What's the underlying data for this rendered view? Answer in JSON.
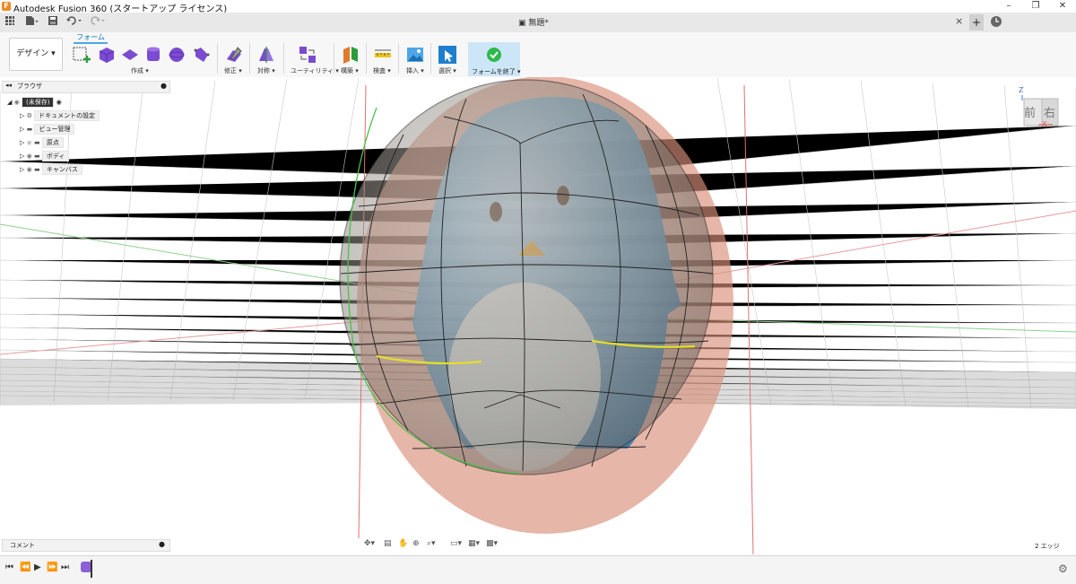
{
  "app": {
    "title": "Autodesk Fusion 360 (スタートアップ ライセンス)",
    "logo": "F",
    "window_buttons": [
      "–",
      "❐",
      "✕"
    ]
  },
  "qat": {
    "apps_icon": "apps-grid-icon",
    "file_icon": "file-icon",
    "save_icon": "save-icon",
    "undo_icon": "undo-icon",
    "redo_icon": "redo-icon",
    "document_title": "無題*",
    "close_tab": "×",
    "new_tab": "+"
  },
  "toolbar": {
    "workspace": "デザイン ▾",
    "active_tab": "フォーム",
    "groups": [
      {
        "label": "作成 ▾"
      },
      {
        "label": "修正 ▾"
      },
      {
        "label": "対称 ▾"
      },
      {
        "label": "ユーティリティ ▾"
      },
      {
        "label": "構築 ▾"
      },
      {
        "label": "検査 ▾"
      },
      {
        "label": "挿入 ▾"
      },
      {
        "label": "選択 ▾"
      },
      {
        "label": "フォームを終了 ▾"
      }
    ]
  },
  "browser": {
    "title": "ブラウザ",
    "collapse": "◂◂",
    "root": "(未保存)",
    "items": [
      {
        "label": "ドキュメントの設定"
      },
      {
        "label": "ビュー管理"
      },
      {
        "label": "原点"
      },
      {
        "label": "ボディ"
      },
      {
        "label": "キャンバス"
      }
    ]
  },
  "viewcube": {
    "front": "前",
    "right": "右",
    "z": "Z",
    "x": "X"
  },
  "comment": {
    "label": "コメント"
  },
  "status": {
    "selection": "2 エッジ"
  },
  "colors": {
    "accent": "#4ea6e8",
    "finish_bg": "#cde6f7",
    "finish_check": "#2db84d",
    "canvas_pink": "#d98f7a",
    "penguin_blue": "#3f93c9",
    "selected_edge": "#e3df2a"
  }
}
